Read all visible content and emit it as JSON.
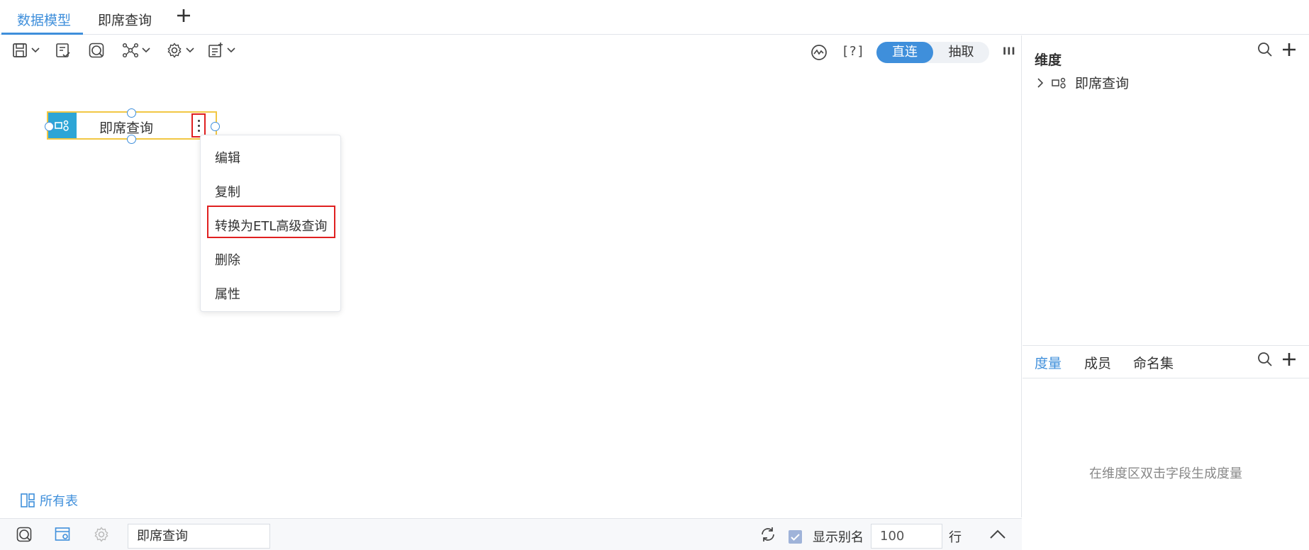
{
  "tabs": [
    {
      "label": "数据模型",
      "active": true
    },
    {
      "label": "即席查询",
      "active": false
    }
  ],
  "toolbar": {
    "bracket_help": "[?]",
    "conn_direct": "直连",
    "conn_extract": "抽取",
    "more": "III"
  },
  "node": {
    "label": "即席查询"
  },
  "context_menu": {
    "items": [
      "编辑",
      "复制",
      "转换为ETL高级查询",
      "删除",
      "属性"
    ]
  },
  "all_tables": "所有表",
  "bottom": {
    "query_name": "即席查询",
    "show_alias_label": "显示别名",
    "row_count": "100",
    "row_unit": "行"
  },
  "right_panel": {
    "dimension_title": "维度",
    "dimension_items": [
      "即席查询"
    ],
    "measure_tabs": [
      "度量",
      "成员",
      "命名集"
    ],
    "measure_hint": "在维度区双击字段生成度量"
  },
  "colors": {
    "accent": "#3f8fdb",
    "node_border": "#f2c744",
    "node_icon_bg": "#2da5d6",
    "highlight": "#e02020"
  }
}
